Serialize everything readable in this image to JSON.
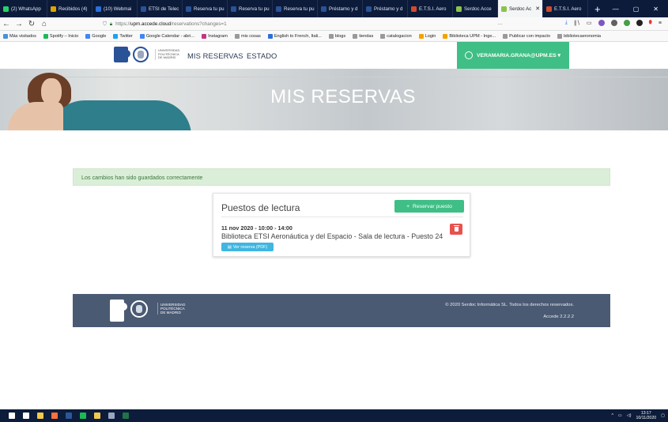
{
  "browser": {
    "tabs": [
      {
        "label": "(2) WhatsApp",
        "color": "#25d366"
      },
      {
        "label": "Recibidos (4)",
        "color": "#e0a200"
      },
      {
        "label": "(10) Webmai",
        "color": "#2a6fdb"
      },
      {
        "label": "ETSI de Telec",
        "color": "#2a5297"
      },
      {
        "label": "Reserva tu pu",
        "color": "#2a5297"
      },
      {
        "label": "Reserva tu pu",
        "color": "#2a5297"
      },
      {
        "label": "Reserva tu pu",
        "color": "#2a5297"
      },
      {
        "label": "Préstamo y d",
        "color": "#2a5297"
      },
      {
        "label": "Préstamo y d",
        "color": "#2a5297"
      },
      {
        "label": "E.T.S.I. Aero",
        "color": "#d04b2e"
      },
      {
        "label": "Serdoc Acce",
        "color": "#8bc34a"
      },
      {
        "label": "Serdoc Ac",
        "color": "#8bc34a",
        "active": true
      },
      {
        "label": "E.T.S.I. Aero",
        "color": "#d04b2e"
      }
    ],
    "new_tab": "+",
    "window_controls": [
      "—",
      "▢",
      "✕"
    ],
    "url_prefix": "https://",
    "url_domain": "upm.accede.cloud",
    "url_path": "/reservations?changes=1",
    "url_dots": "···",
    "bookmarks": [
      {
        "label": "Más visitados",
        "color": "#4a90d9"
      },
      {
        "label": "Spotify – Inicio",
        "color": "#1db954"
      },
      {
        "label": "Google",
        "color": "#4285f4"
      },
      {
        "label": "Twitter",
        "color": "#1da1f2"
      },
      {
        "label": "Google Calendar - abri...",
        "color": "#4285f4"
      },
      {
        "label": "Instagram",
        "color": "#c13584"
      },
      {
        "label": "mis cosas",
        "color": "#999999"
      },
      {
        "label": "English to French, Itali...",
        "color": "#2a6fdb"
      },
      {
        "label": "blogs",
        "color": "#999999"
      },
      {
        "label": "tiendas",
        "color": "#999999"
      },
      {
        "label": "catalogacion",
        "color": "#999999"
      },
      {
        "label": "Login",
        "color": "#f4a100"
      },
      {
        "label": "Biblioteca UPM - Inge...",
        "color": "#f4a100"
      },
      {
        "label": "Publicar con impacto",
        "color": "#999999"
      },
      {
        "label": "bibliotecaeronomia",
        "color": "#999999"
      }
    ]
  },
  "site": {
    "logo_text": "UNIVERSIDAD POLITÉCNICA DE MADRID",
    "menu": {
      "my_reservations": "MIS RESERVAS",
      "status": "ESTADO"
    },
    "user": "VERAMARIA.GRANA@UPM.ES ▾",
    "banner_title": "MIS RESERVAS",
    "alert": "Los cambios han sido guardados correctamente",
    "card": {
      "title": "Puestos de lectura",
      "reserve_button": "Reservar puesto",
      "reservation": {
        "datetime": "11 nov 2020 - 10:00 - 14:00",
        "place": "Biblioteca ETSI Aeronáutica y del Espacio - Sala de lectura - Puesto 24",
        "pdf_button": "Ver reserva (PDF)"
      }
    },
    "footer": {
      "logo_text": "UNIVERSIDAD POLITÉCNICA DE MADRID",
      "copyright": "© 2020 Serdoc Informática SL. Todos los derechos reservados.",
      "version": "Accede 2.2.2.2"
    }
  },
  "taskbar": {
    "apps": [
      {
        "name": "windows-start",
        "color": "#ffffff"
      },
      {
        "name": "search",
        "color": "#ffffff"
      },
      {
        "name": "folder",
        "color": "#f2c94c"
      },
      {
        "name": "firefox",
        "color": "#ff7139"
      },
      {
        "name": "word",
        "color": "#2b579a"
      },
      {
        "name": "spotify",
        "color": "#1db954"
      },
      {
        "name": "file-explorer",
        "color": "#f2c94c"
      },
      {
        "name": "pen",
        "color": "#9aa7bf"
      },
      {
        "name": "excel",
        "color": "#217346"
      }
    ],
    "time": "13:17",
    "date": "10/11/2020"
  }
}
